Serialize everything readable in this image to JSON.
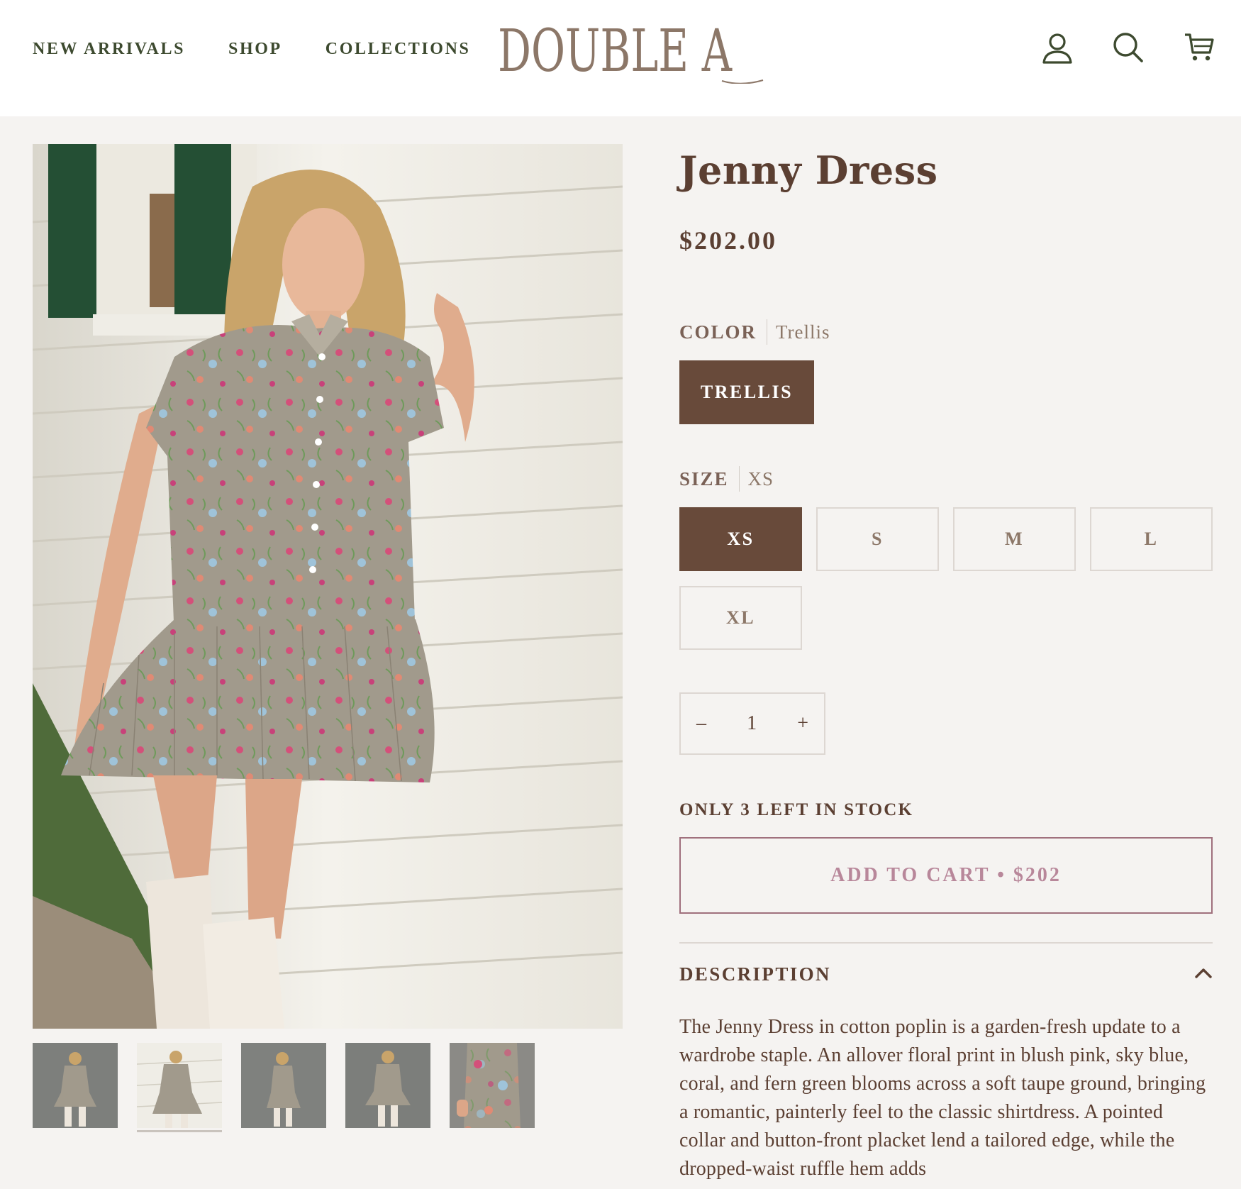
{
  "header": {
    "nav": [
      {
        "label": "NEW ARRIVALS"
      },
      {
        "label": "SHOP"
      },
      {
        "label": "COLLECTIONS"
      }
    ],
    "logo_text": "DOUBLE A",
    "icons": [
      "account-icon",
      "search-icon",
      "cart-icon"
    ]
  },
  "gallery": {
    "thumbnail_count": 5,
    "active_thumbnail": 2
  },
  "product": {
    "title": "Jenny Dress",
    "price": "$202.00",
    "color": {
      "label": "COLOR",
      "selected": "Trellis",
      "options": [
        "TRELLIS"
      ]
    },
    "size": {
      "label": "SIZE",
      "selected": "XS",
      "options": [
        "XS",
        "S",
        "M",
        "L",
        "XL"
      ]
    },
    "quantity": {
      "minus": "–",
      "value": "1",
      "plus": "+"
    },
    "stock_message": "ONLY 3 LEFT IN STOCK",
    "add_to_cart": "ADD TO CART • $202",
    "description": {
      "title": "DESCRIPTION",
      "text": "The Jenny Dress in cotton poplin is a garden-fresh update to a wardrobe staple. An allover floral print in blush pink, sky blue, coral, and fern green blooms across a soft taupe ground, bringing a romantic, painterly feel to the classic shirtdress. A pointed collar and button-front placket lend a tailored edge, while the dropped-waist ruffle hem adds"
    }
  },
  "colors": {
    "brown": "#684a3a",
    "text": "#5b3f32",
    "nav_green": "#3d4a2f",
    "cart_pink": "#b8879a",
    "background": "#f5f3f1"
  }
}
